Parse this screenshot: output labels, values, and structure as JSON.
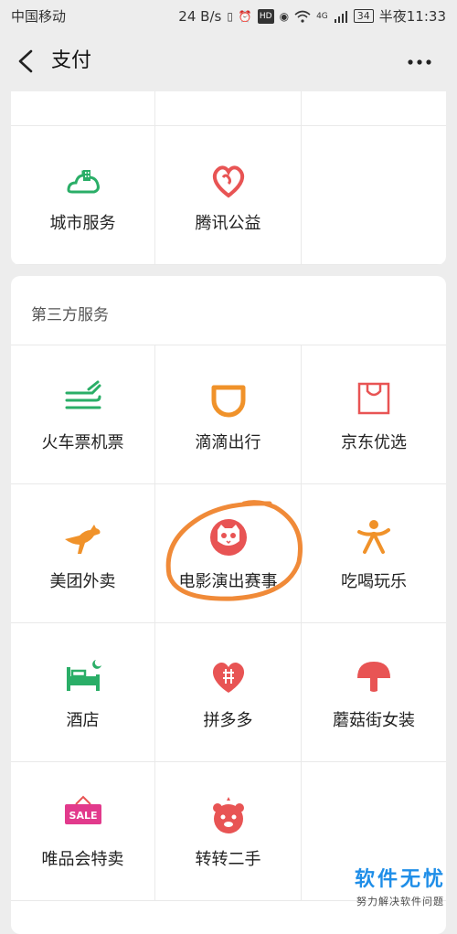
{
  "status": {
    "carrier": "中国移动",
    "speed": "24 B/s",
    "battery": "34",
    "time": "半夜11:33",
    "hd": "HD",
    "net": "4G"
  },
  "header": {
    "title": "支付"
  },
  "top_services": [
    {
      "label": ""
    },
    {
      "label": ""
    },
    {
      "label": ""
    },
    {
      "label": "城市服务",
      "icon": "city-icon"
    },
    {
      "label": "腾讯公益",
      "icon": "charity-heart-icon"
    },
    {
      "label": ""
    }
  ],
  "third_party": {
    "title": "第三方服务",
    "items": [
      {
        "label": "火车票机票",
        "icon": "train-plane-icon"
      },
      {
        "label": "滴滴出行",
        "icon": "didi-icon"
      },
      {
        "label": "京东优选",
        "icon": "jd-bag-icon"
      },
      {
        "label": "美团外卖",
        "icon": "kangaroo-icon"
      },
      {
        "label": "电影演出赛事",
        "icon": "movie-cat-icon"
      },
      {
        "label": "吃喝玩乐",
        "icon": "person-fun-icon"
      },
      {
        "label": "酒店",
        "icon": "hotel-bed-icon"
      },
      {
        "label": "拼多多",
        "icon": "pinduoduo-heart-icon"
      },
      {
        "label": "蘑菇街女装",
        "icon": "mushroom-icon"
      },
      {
        "label": "唯品会特卖",
        "icon": "sale-sign-icon"
      },
      {
        "label": "转转二手",
        "icon": "bear-icon"
      },
      {
        "label": ""
      }
    ]
  },
  "watermark": {
    "main": "软件无忧",
    "sub": "努力解决软件问题"
  },
  "sale_text": "SALE",
  "colors": {
    "green": "#2aae67",
    "orange": "#f0922a",
    "red": "#e85454",
    "annotation": "#f08a38"
  }
}
